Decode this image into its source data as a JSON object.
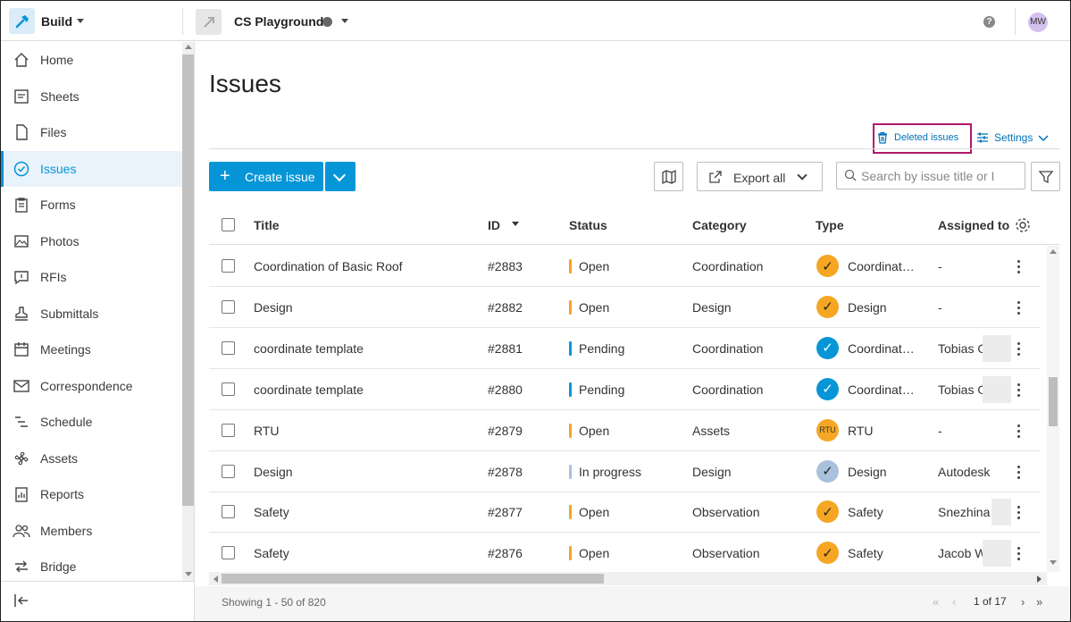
{
  "topbar": {
    "app_name": "Build",
    "project_name": "CS Playground",
    "help_label": "?",
    "user_initials": "MW"
  },
  "sidebar": {
    "items": [
      {
        "label": "Home",
        "icon": "home-icon"
      },
      {
        "label": "Sheets",
        "icon": "sheets-icon"
      },
      {
        "label": "Files",
        "icon": "file-icon"
      },
      {
        "label": "Issues",
        "icon": "issues-check-icon",
        "active": true
      },
      {
        "label": "Forms",
        "icon": "clipboard-icon"
      },
      {
        "label": "Photos",
        "icon": "photo-icon"
      },
      {
        "label": "RFIs",
        "icon": "rfi-icon"
      },
      {
        "label": "Submittals",
        "icon": "stamp-icon"
      },
      {
        "label": "Meetings",
        "icon": "calendar-icon"
      },
      {
        "label": "Correspondence",
        "icon": "mail-icon"
      },
      {
        "label": "Schedule",
        "icon": "schedule-icon"
      },
      {
        "label": "Assets",
        "icon": "fan-icon"
      },
      {
        "label": "Reports",
        "icon": "report-icon"
      },
      {
        "label": "Members",
        "icon": "members-icon"
      },
      {
        "label": "Bridge",
        "icon": "bridge-icon"
      }
    ]
  },
  "main": {
    "title": "Issues",
    "deleted_issues": "Deleted issues",
    "settings": "Settings",
    "create_issue": "Create issue",
    "export_all": "Export all",
    "search_placeholder": "Search by issue title or I"
  },
  "table": {
    "headers": {
      "title": "Title",
      "id": "ID",
      "status": "Status",
      "category": "Category",
      "type": "Type",
      "assigned": "Assigned to"
    },
    "rows": [
      {
        "title": "Coordination of Basic Roof",
        "id": "#2883",
        "status": "Open",
        "status_color": "#f5a623",
        "category": "Coordination",
        "type": "Coordinat…",
        "type_color": "#f5a623",
        "type_glyph": "✓",
        "assigned": "-"
      },
      {
        "title": "Design",
        "id": "#2882",
        "status": "Open",
        "status_color": "#f5a623",
        "category": "Design",
        "type": "Design",
        "type_color": "#f5a623",
        "type_glyph": "✓",
        "assigned": "-"
      },
      {
        "title": "coordinate template",
        "id": "#2881",
        "status": "Pending",
        "status_color": "#0696d7",
        "category": "Coordination",
        "type": "Coordinat…",
        "type_color": "#0696d7",
        "type_glyph": "✓",
        "assigned": "Tobias O"
      },
      {
        "title": "coordinate template",
        "id": "#2880",
        "status": "Pending",
        "status_color": "#0696d7",
        "category": "Coordination",
        "type": "Coordinat…",
        "type_color": "#0696d7",
        "type_glyph": "✓",
        "assigned": "Tobias O"
      },
      {
        "title": "RTU",
        "id": "#2879",
        "status": "Open",
        "status_color": "#f5a623",
        "category": "Assets",
        "type": "RTU",
        "type_color": "#f5a623",
        "type_glyph": "RTU",
        "assigned": "-"
      },
      {
        "title": "Design",
        "id": "#2878",
        "status": "In progress",
        "status_color": "#a9c1dc",
        "category": "Design",
        "type": "Design",
        "type_color": "#a9c1dc",
        "type_glyph": "✓",
        "assigned": "Autodesk"
      },
      {
        "title": "Safety",
        "id": "#2877",
        "status": "Open",
        "status_color": "#f5a623",
        "category": "Observation",
        "type": "Safety",
        "type_color": "#f5a623",
        "type_glyph": "✓",
        "assigned": "Snezhina S"
      },
      {
        "title": "Safety",
        "id": "#2876",
        "status": "Open",
        "status_color": "#f5a623",
        "category": "Observation",
        "type": "Safety",
        "type_color": "#f5a623",
        "type_glyph": "✓",
        "assigned": "Jacob Wes"
      }
    ]
  },
  "footer": {
    "showing": "Showing 1 - 50 of 820",
    "page_current": "1",
    "page_of": "of 17"
  },
  "colors": {
    "accent": "#0696d7",
    "highlight_box": "#b0196a"
  }
}
